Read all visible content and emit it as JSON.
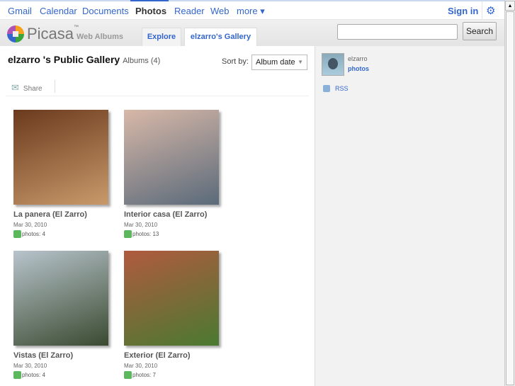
{
  "topnav": {
    "items": [
      "Gmail",
      "Calendar",
      "Documents",
      "Photos",
      "Reader",
      "Web",
      "more ▾"
    ],
    "active": "Photos",
    "sign_in": "Sign in"
  },
  "header": {
    "brand": "Picasa",
    "tm": "™",
    "subtitle": "Web Albums",
    "tabs": [
      "Explore",
      "elzarro's Gallery"
    ],
    "search_value": "",
    "search_button": "Search"
  },
  "main": {
    "title": "elzarro 's Public Gallery",
    "albums_count": "Albums (4)",
    "sort_label": "Sort by:",
    "sort_value": "Album date",
    "share": "Share",
    "albums": [
      {
        "name": "La panera (El Zarro)",
        "date": "Mar 30, 2010",
        "photos": "photos: 4",
        "colors": [
          "#6b3a1e",
          "#c89a6a"
        ]
      },
      {
        "name": "Interior casa (El Zarro)",
        "date": "Mar 30, 2010",
        "photos": "photos: 13",
        "colors": [
          "#d8b8a8",
          "#5a6a7a"
        ]
      },
      {
        "name": "Vistas (El Zarro)",
        "date": "Mar 30, 2010",
        "photos": "photos: 4",
        "colors": [
          "#b8c4cc",
          "#3a4a30"
        ]
      },
      {
        "name": "Exterior (El Zarro)",
        "date": "Mar 30, 2010",
        "photos": "photos: 7",
        "colors": [
          "#b05a40",
          "#4a7a30"
        ]
      }
    ]
  },
  "sidebar": {
    "user": "elzarro",
    "photos_link": "photos",
    "rss": "RSS"
  }
}
